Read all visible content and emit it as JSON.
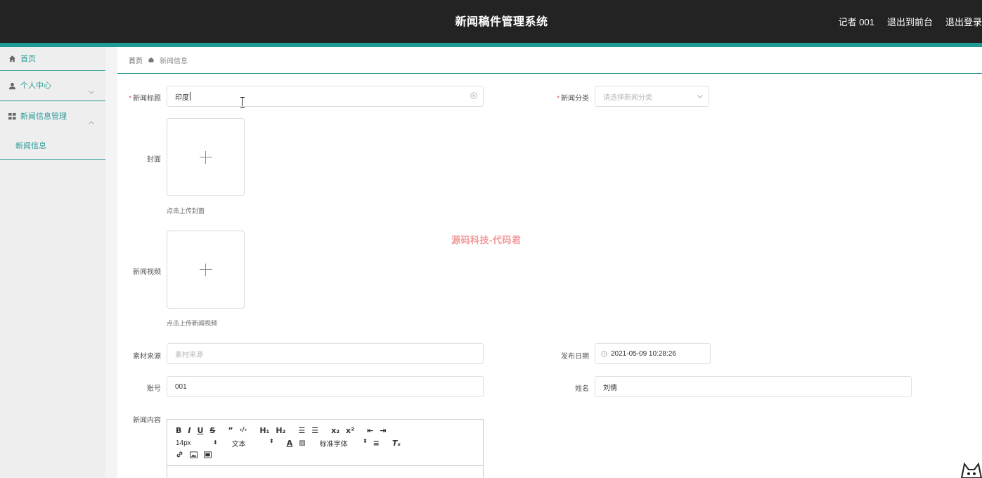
{
  "header": {
    "title": "新闻稿件管理系统",
    "user": "记者 001",
    "to_front": "退出到前台",
    "logout": "退出登录"
  },
  "sidebar": {
    "items": [
      {
        "label": "首页",
        "icon": "home-icon"
      },
      {
        "label": "个人中心",
        "icon": "user-icon"
      },
      {
        "label": "新闻信息管理",
        "icon": "grid-icon"
      }
    ],
    "submenu_label": "新闻信息"
  },
  "breadcrumb": {
    "home": "首页",
    "current": "新闻信息"
  },
  "form": {
    "title_label": "新闻标题",
    "title_value": "印度",
    "category_label": "新闻分类",
    "category_placeholder": "请选择新闻分类",
    "cover_label": "封面",
    "cover_hint": "点击上传封面",
    "video_label": "新闻视频",
    "video_hint": "点击上传新闻视频",
    "source_label": "素材来源",
    "source_placeholder": "素材来源",
    "date_label": "发布日期",
    "date_value": "2021-05-09 10:28:26",
    "account_label": "账号",
    "account_value": "001",
    "name_label": "姓名",
    "name_value": "刘倩",
    "content_label": "新闻内容"
  },
  "editor": {
    "font_size": "14px",
    "header_select": "文本",
    "font_family": "标准字体"
  },
  "watermark": "源码科技-代码君",
  "colors": {
    "accent": "#1e9b96",
    "header_bg": "#232323",
    "sidebar_bg": "#eeeeee"
  }
}
